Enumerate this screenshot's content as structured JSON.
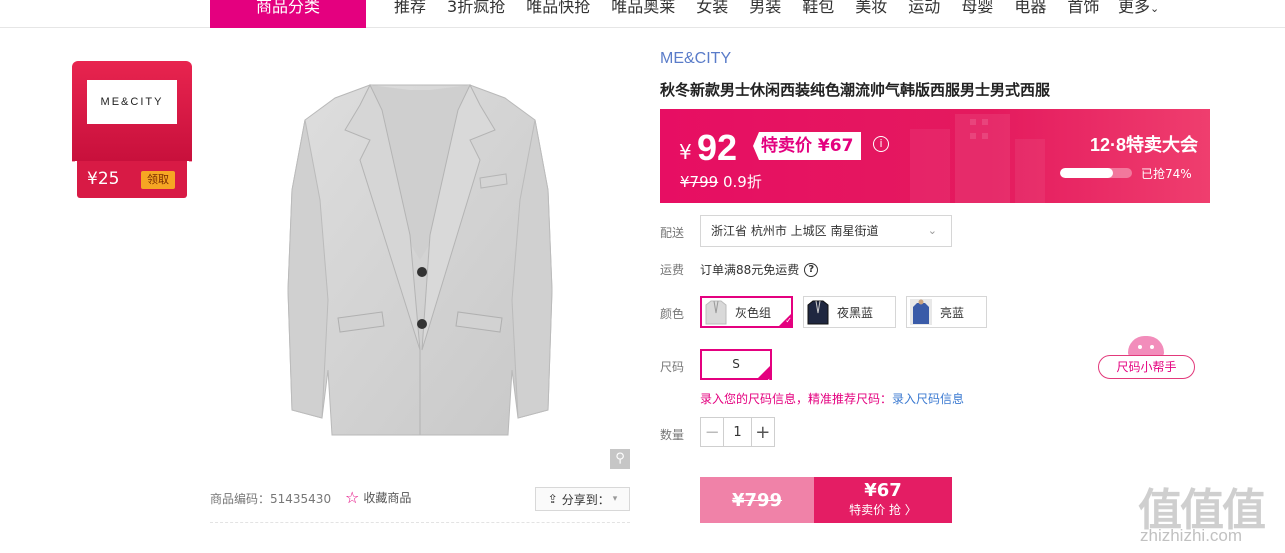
{
  "nav": {
    "category_button": "商品分类",
    "items": [
      "推荐",
      "3折疯抢",
      "唯品快抢",
      "唯品奥莱",
      "女装",
      "男装",
      "鞋包",
      "美妆",
      "运动",
      "母婴",
      "电器",
      "首饰"
    ],
    "more": "更多"
  },
  "coupon": {
    "logo_text": "ME&CITY",
    "amount": "¥25",
    "claim_label": "领取"
  },
  "product": {
    "code_label": "商品编码：51435430",
    "favorite_label": "收藏商品",
    "share_label": "分享到："
  },
  "detail": {
    "brand": "ME&CITY",
    "title": "秋冬新款男士休闲西装纯色潮流帅气韩版西服男士男式西服",
    "price": {
      "yen": "¥",
      "value": "92",
      "special_label": "特卖价 ¥67",
      "original": "¥799",
      "discount": "0.9折",
      "event": "12·8特卖大会",
      "sold_text": "已抢74%",
      "sold_fraction": 0.74
    },
    "delivery_label": "配送",
    "address": "浙江省 杭州市 上城区 南星街道",
    "shipping_label": "运费",
    "shipping_text": "订单满88元免运费",
    "color_label": "颜色",
    "colors": [
      "灰色组",
      "夜黑蓝",
      "亮蓝"
    ],
    "size_label": "尺码",
    "sizes": [
      "S"
    ],
    "size_helper": "尺码小帮手",
    "size_tip": "录入您的尺码信息，精准推荐尺码：",
    "size_tip_link": "录入尺码信息",
    "qty_label": "数量",
    "qty_value": "1",
    "buy_original": "¥799",
    "buy_price": "¥67",
    "buy_label": "特卖价 抢 〉"
  },
  "watermark": {
    "main": "值值值",
    "sub": "zhizhizhi.com"
  },
  "colors": {
    "accent": "#e4007f",
    "brand_blue": "#5a7cc9"
  }
}
